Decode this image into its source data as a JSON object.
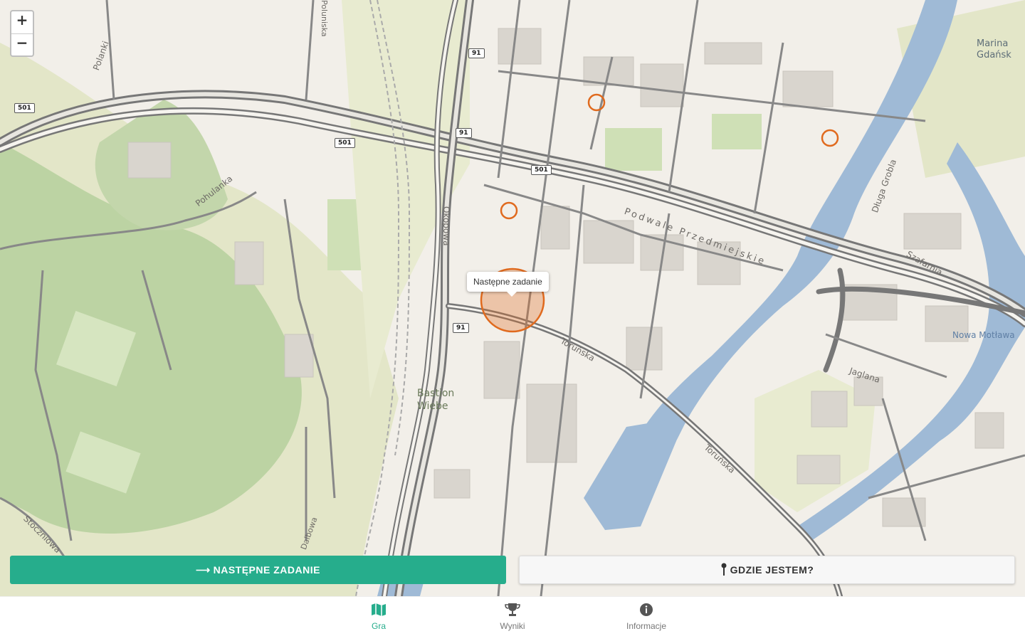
{
  "map": {
    "zoom_in": "+",
    "zoom_out": "−",
    "tooltip": "Następne zadanie",
    "labels": {
      "marina": "Marina Gdańsk",
      "podwale": "Podwale Przedmiejskie",
      "torunska1": "Toruńska",
      "torunska2": "Toruńska",
      "bastion": "Bastion Wiebe",
      "okopowa": "Okopowa",
      "pohulanka": "Pohulanka",
      "polanki": "Polanki",
      "stoczniowa": "Stoczniowa",
      "jaglana": "Jaglana",
      "nowa_motlawa": "Nowa Motława",
      "dluga_grobla": "Długa Grobla",
      "szafarnia": "Szafarnia",
      "poluniska": "Poluniska",
      "dalbowa": "Dalbowa"
    },
    "shields": [
      "501",
      "501",
      "501",
      "91",
      "91",
      "91"
    ],
    "colors": {
      "water": "#9fbad6",
      "park": "#c8d8b0",
      "road": "#777777",
      "marker": "#e06a1e",
      "accent": "#26ad8c"
    }
  },
  "actions": {
    "next_task_icon": "arrow-right-icon",
    "next_task": "NASTĘPNE ZADANIE",
    "where_am_i_icon": "pin-icon",
    "where_am_i": "GDZIE JESTEM?"
  },
  "nav": {
    "items": [
      {
        "label": "Gra",
        "icon": "map-icon",
        "active": true
      },
      {
        "label": "Wyniki",
        "icon": "trophy-icon",
        "active": false
      },
      {
        "label": "Informacje",
        "icon": "info-icon",
        "active": false
      }
    ]
  }
}
